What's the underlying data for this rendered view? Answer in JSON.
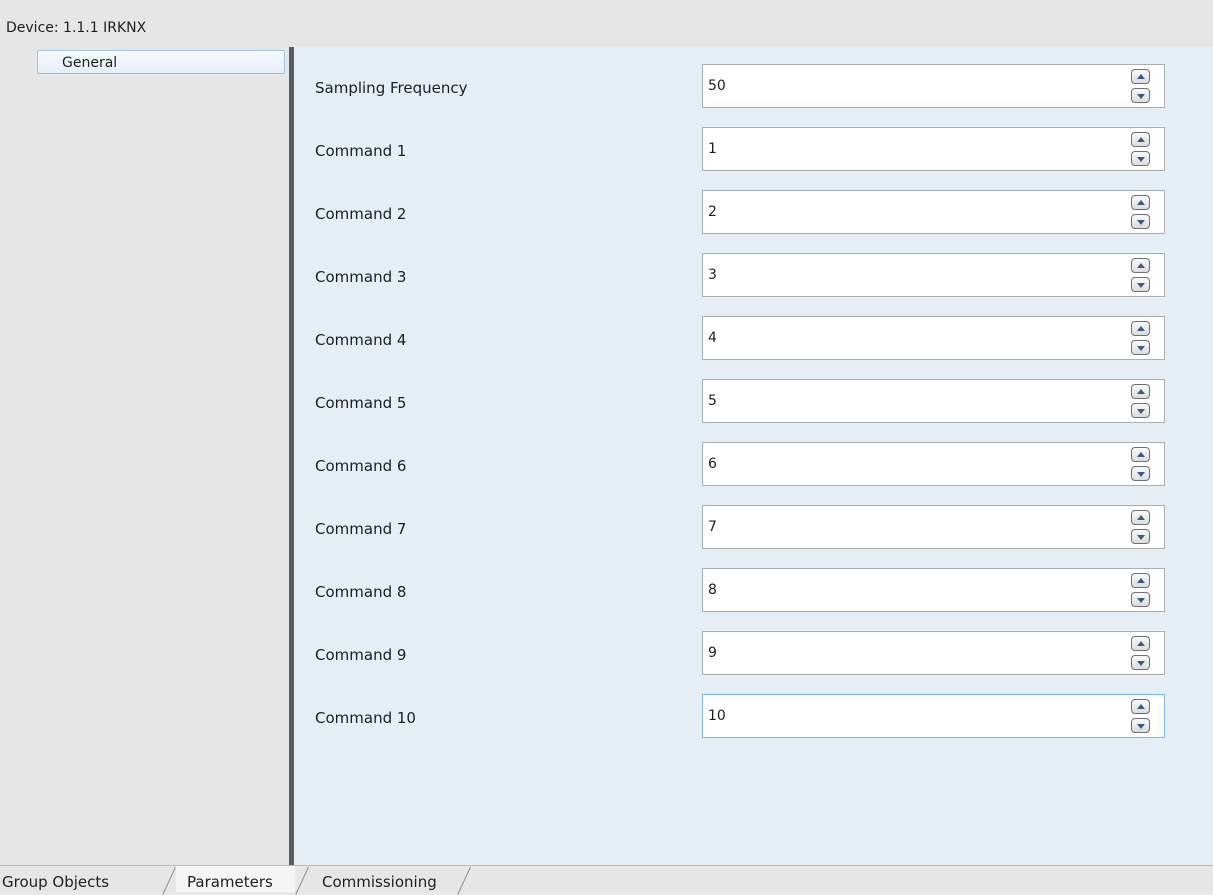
{
  "header": {
    "device_label": "Device: 1.1.1  IRKNX"
  },
  "sidebar": {
    "items": [
      {
        "label": "General"
      }
    ]
  },
  "params": [
    {
      "label": "Sampling Frequency",
      "value": "50"
    },
    {
      "label": "Command 1",
      "value": "1"
    },
    {
      "label": "Command 2",
      "value": "2"
    },
    {
      "label": "Command 3",
      "value": "3"
    },
    {
      "label": "Command 4",
      "value": "4"
    },
    {
      "label": "Command 5",
      "value": "5"
    },
    {
      "label": "Command 6",
      "value": "6"
    },
    {
      "label": "Command 7",
      "value": "7"
    },
    {
      "label": "Command 8",
      "value": "8"
    },
    {
      "label": "Command 9",
      "value": "9"
    },
    {
      "label": "Command 10",
      "value": "10"
    }
  ],
  "tabs": [
    {
      "label": "Group Objects",
      "active": false
    },
    {
      "label": "Parameters",
      "active": true
    },
    {
      "label": "Commissioning",
      "active": false
    }
  ],
  "icons": {
    "spin_up": "chevron-up-icon",
    "spin_down": "chevron-down-icon"
  },
  "colors": {
    "panel_bg": "#e5eef5",
    "splitter": "#5c5c5c",
    "selected_border": "#9cc2e6"
  }
}
